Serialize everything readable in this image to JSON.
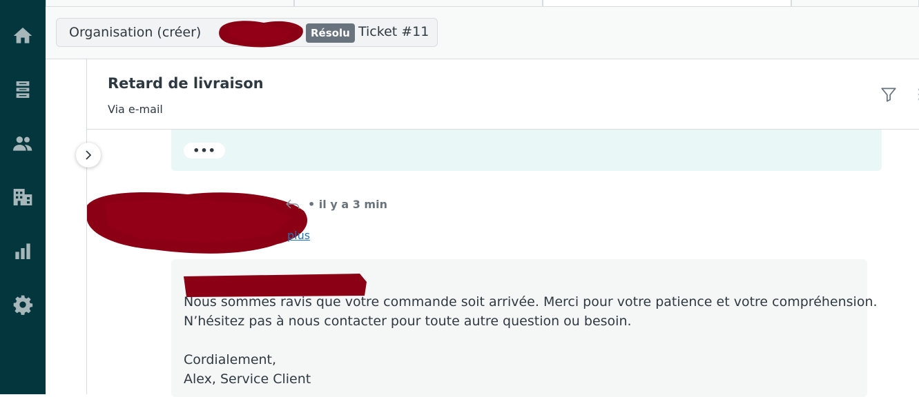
{
  "breadcrumb": {
    "organization": "Organisation (créer)",
    "status": "Résolu",
    "ticket": "Ticket #11"
  },
  "ticket": {
    "subject": "Retard de livraison",
    "channel": "Via e-mail"
  },
  "conversation": {
    "previous_more": "•••",
    "comment": {
      "time": "•  il y a 3 min",
      "more_link": "plus",
      "body_lines": [
        "Nous sommes ravis que votre commande soit arrivée. Merci pour votre patience et votre compréhension.",
        "N’hésitez pas à nous contacter pour toute autre question ou besoin.",
        "",
        "Cordialement,",
        "Alex, Service Client"
      ]
    }
  },
  "nav": {
    "icons": [
      "home-icon",
      "views-icon",
      "customers-icon",
      "organizations-icon",
      "reporting-icon",
      "admin-gear-icon"
    ]
  },
  "colors": {
    "nav_bg": "#03363d",
    "nav_icon": "#a6b6b9",
    "status_badge": "#68737d",
    "prev_message_bg": "#eaf7f7",
    "message_bg": "#f5f6f6",
    "redaction": "#8b0014",
    "link": "#1f73b7"
  }
}
